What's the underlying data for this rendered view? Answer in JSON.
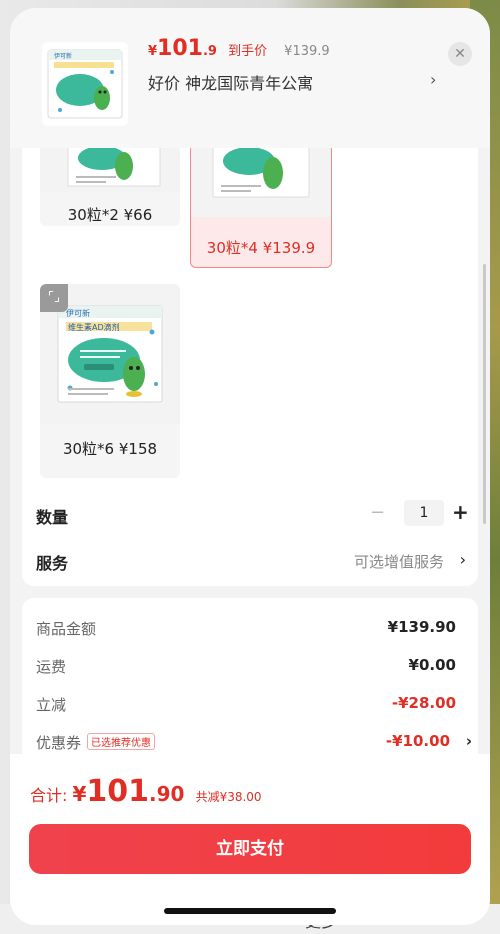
{
  "background": {
    "bottom_text": "更多"
  },
  "header": {
    "price_symbol": "¥",
    "price_integer": "101",
    "price_decimal": ".9",
    "price_tag": "到手价",
    "original_price": "¥139.9",
    "shop_name": "好价  神龙国际青年公寓",
    "chevron": "›",
    "close_symbol": "✕"
  },
  "options": [
    {
      "label": "30粒*2 ¥66",
      "selected": false
    },
    {
      "label": "30粒*4 ¥139.9",
      "selected": true
    },
    {
      "label": "30粒*6 ¥158",
      "selected": false
    }
  ],
  "quantity": {
    "label": "数量",
    "minus": "−",
    "value": "1",
    "plus": "+"
  },
  "service": {
    "label": "服务",
    "value": "可选增值服务",
    "chevron": "›"
  },
  "summary": {
    "goods_label": "商品金额",
    "goods_value": "¥139.90",
    "shipping_label": "运费",
    "shipping_value": "¥0.00",
    "discount_label": "立减",
    "discount_value": "-¥28.00",
    "coupon_label": "优惠券",
    "coupon_tag": "已选推荐优惠",
    "coupon_value": "-¥10.00",
    "coupon_chevron": "›"
  },
  "footer": {
    "total_label": "合计: ",
    "total_symbol": "¥",
    "total_integer": "101",
    "total_decimal": ".90",
    "total_saved": "共减¥38.00",
    "pay_button": "立即支付"
  },
  "colors": {
    "accent": "#e02e24",
    "pay_button": "#f0424d"
  },
  "icons": {
    "expand": "expand-icon",
    "close": "close-icon",
    "chevron": "chevron-right-icon"
  }
}
